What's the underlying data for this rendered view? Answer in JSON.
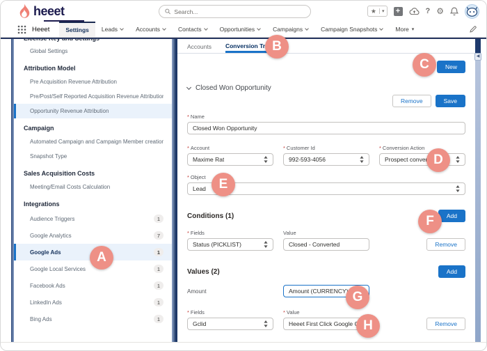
{
  "colors": {
    "accent_blue": "#1a73c8",
    "brand_coral": "#ef8075",
    "navy": "#1c1b4e",
    "annotation_salmon": "#ee9086"
  },
  "header": {
    "logo_text": "heeet",
    "search_placeholder": "Search...",
    "icons": {
      "app_launcher": "waffle-grid",
      "favorites": "★",
      "favorites_caret": "▾",
      "global_actions": "+",
      "guidance_center": "cloud",
      "help": "?",
      "setup": "⚙",
      "notifications": "bell",
      "avatar": "astro-avatar",
      "edit": "pencil"
    }
  },
  "nav": {
    "app_name": "Heeet",
    "tabs": [
      {
        "label": "Settings",
        "active": true
      },
      {
        "label": "Leads"
      },
      {
        "label": "Accounts"
      },
      {
        "label": "Contacts"
      },
      {
        "label": "Opportunities"
      },
      {
        "label": "Campaigns"
      },
      {
        "label": "Campaign Snapshots"
      },
      {
        "label": "More"
      }
    ]
  },
  "sidebar": {
    "clipped_header": "License Key and Settings",
    "groups": [
      {
        "items": [
          {
            "label": "Global Settings"
          }
        ]
      },
      {
        "header": "Attribution Model",
        "items": [
          {
            "label": "Pre Acquisition Revenue Attribution"
          },
          {
            "label": "Pre/Post/Self Reported Acquisition Revenue Attribution"
          },
          {
            "label": "Opportunity Revenue Attribution",
            "selected": true
          }
        ]
      },
      {
        "header": "Campaign",
        "items": [
          {
            "label": "Automated Campaign and Campaign Member creation"
          },
          {
            "label": "Snapshot Type"
          }
        ]
      },
      {
        "header": "Sales Acquisition Costs",
        "items": [
          {
            "label": "Meeting/Email Costs Calculation"
          }
        ]
      },
      {
        "header": "Integrations",
        "items": [
          {
            "label": "Audience Triggers",
            "badge": "1"
          },
          {
            "label": "Google Analytics",
            "badge": "7"
          },
          {
            "label": "Google Ads",
            "badge": "1",
            "selected": true
          },
          {
            "label": "Google Local Services",
            "badge": "1"
          },
          {
            "label": "Facebook Ads",
            "badge": "1"
          },
          {
            "label": "LinkedIn Ads",
            "badge": "1"
          },
          {
            "label": "Bing Ads",
            "badge": "1"
          }
        ]
      }
    ]
  },
  "main": {
    "required_marker": "*",
    "tabs": {
      "accounts": "Accounts",
      "conversion_triggers": "Conversion Triggers"
    },
    "new_button": "New",
    "trigger": {
      "title": "Closed Won Opportunity",
      "remove_button": "Remove",
      "save_button": "Save",
      "name_label": "Name",
      "name_value": "Closed Won Opportunity",
      "account_label": "Account",
      "account_value": "Maxime Rat",
      "customer_id_label": "Customer Id",
      "customer_id_value": "992-593-4056",
      "conversion_action_label": "Conversion Action",
      "conversion_action_value": "Prospect converti",
      "object_label": "Object",
      "object_value": "Lead"
    },
    "conditions": {
      "title": "Conditions (1)",
      "add_button": "Add",
      "fields_label": "Fields",
      "fields_value": "Status (PICKLIST)",
      "value_label": "Value",
      "value_value": "Closed - Converted",
      "remove_button": "Remove"
    },
    "values": {
      "title": "Values (2)",
      "add_button": "Add",
      "amount_label": "Amount",
      "amount_value": "Amount (CURRENCY)",
      "fields_label": "Fields",
      "fields_value": "Gclid",
      "value_label": "Value",
      "value_value": "Heeet First Click Google Gclid (S",
      "remove_button": "Remove"
    }
  },
  "annotations": {
    "a": "A",
    "b": "B",
    "c": "C",
    "d": "D",
    "e": "E",
    "f": "F",
    "g": "G",
    "h": "H"
  }
}
